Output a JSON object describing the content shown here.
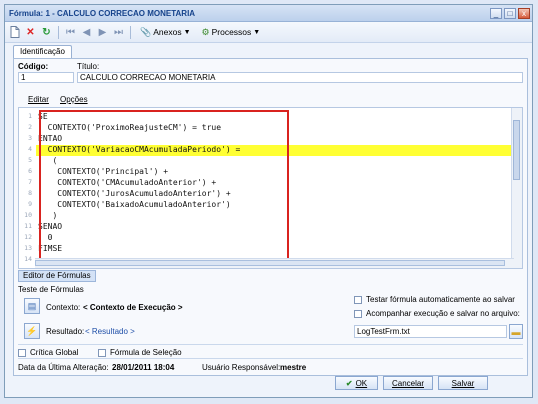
{
  "window": {
    "title": "Fórmula: 1 - CALCULO CORRECAO MONETARIA",
    "minimize": "_",
    "maximize": "□",
    "close": "x"
  },
  "toolbar": {
    "anexos_label": "Anexos",
    "processos_label": "Processos"
  },
  "tabs": [
    {
      "label": "Identificação"
    }
  ],
  "fields": {
    "codigo_label": "Código:",
    "codigo_value": "1",
    "titulo_label": "Título:",
    "titulo_value": "CALCULO CORRECAO MONETARIA"
  },
  "editor_menu": {
    "editar": "Editar",
    "opcoes": "Opções"
  },
  "code_lines": [
    {
      "num": "1",
      "text": "SE"
    },
    {
      "num": "2",
      "text": "  CONTEXTO('ProximoReajusteCM') = true"
    },
    {
      "num": "3",
      "text": "ENTAO"
    },
    {
      "num": "4",
      "text": "  CONTEXTO('VariacaoCMAcumuladaPeriodo') ="
    },
    {
      "num": "5",
      "text": "   ("
    },
    {
      "num": "6",
      "text": "    CONTEXTO('Principal') +"
    },
    {
      "num": "7",
      "text": "    CONTEXTO('CMAcumuladoAnterior') +"
    },
    {
      "num": "8",
      "text": "    CONTEXTO('JurosAcumuladoAnterior') +"
    },
    {
      "num": "9",
      "text": "    CONTEXTO('BaixadoAcumuladoAnterior')"
    },
    {
      "num": "10",
      "text": "   )"
    },
    {
      "num": "11",
      "text": "SENAO"
    },
    {
      "num": "12",
      "text": "  0"
    },
    {
      "num": "13",
      "text": "FIMSE"
    },
    {
      "num": "14",
      "text": ""
    },
    {
      "num": "15",
      "text": ""
    },
    {
      "num": "16",
      "text": ""
    }
  ],
  "editor_tab": "Editor de Fórmulas",
  "teste": {
    "section_title": "Teste de Fórmulas",
    "contexto_label": "Contexto:",
    "contexto_value": "< Contexto de Execução >",
    "resultado_label": "Resultado:",
    "resultado_value": "< Resultado >",
    "testar_auto_label": "Testar fórmula automaticamente ao salvar",
    "acompanhar_label": "Acompanhar execução e salvar no arquivo:",
    "arquivo_value": "LogTestFrm.txt"
  },
  "options": {
    "critica_global": "Crítica Global",
    "formula_selecao": "Fórmula de Seleção"
  },
  "footer": {
    "data_label": "Data da Última Alteração:",
    "data_value": "28/01/2011 18:04",
    "usuario_label": "Usuário Responsável:",
    "usuario_value": "mestre"
  },
  "buttons": {
    "ok": "OK",
    "cancelar": "Cancelar",
    "salvar": "Salvar"
  },
  "colors": {
    "highlight": "#ffff33",
    "annotation_box": "#d9231f",
    "link": "#1f4fa8"
  }
}
